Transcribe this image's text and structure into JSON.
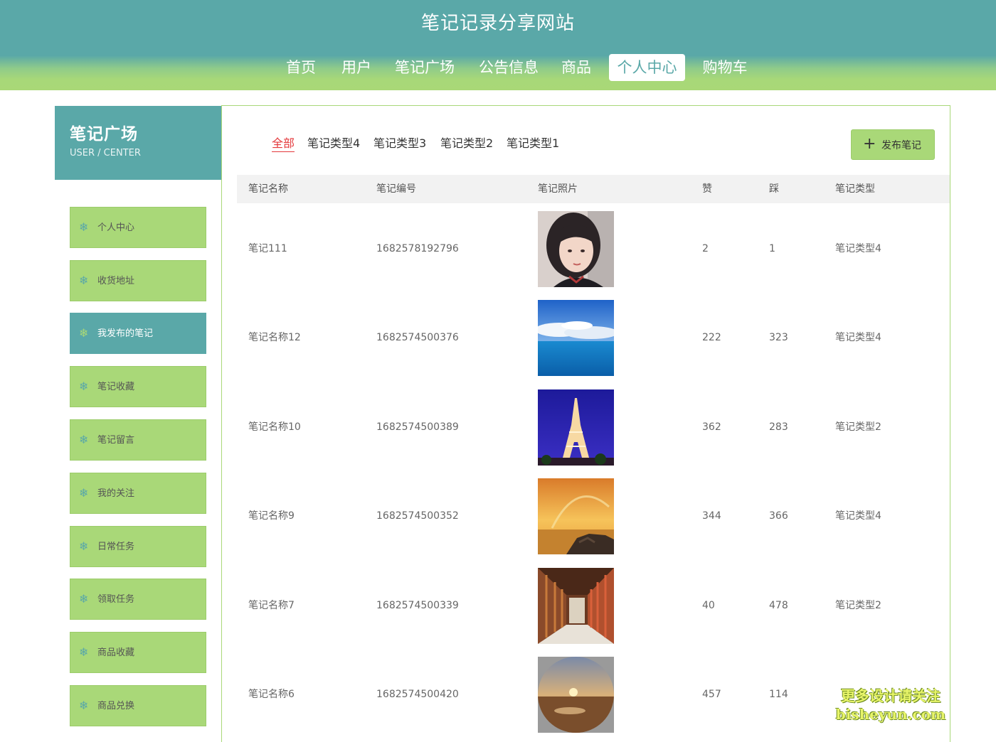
{
  "site": {
    "title": "笔记记录分享网站"
  },
  "nav": [
    "首页",
    "用户",
    "笔记广场",
    "公告信息",
    "商品",
    "个人中心",
    "购物车"
  ],
  "nav_active": "个人中心",
  "sidebar": {
    "title": "笔记广场",
    "subtitle": "USER / CENTER",
    "items": [
      "个人中心",
      "收货地址",
      "我发布的笔记",
      "笔记收藏",
      "笔记留言",
      "我的关注",
      "日常任务",
      "领取任务",
      "商品收藏",
      "商品兑换"
    ],
    "active": "我发布的笔记"
  },
  "filters": [
    "全部",
    "笔记类型4",
    "笔记类型3",
    "笔记类型2",
    "笔记类型1"
  ],
  "filter_active": "全部",
  "publish_label": "发布笔记",
  "table": {
    "headers": [
      "笔记名称",
      "笔记编号",
      "笔记照片",
      "赞",
      "踩",
      "笔记类型"
    ],
    "rows": [
      {
        "name": "笔记111",
        "code": "1682578192796",
        "photo": "portrait-photo",
        "likes": "2",
        "dislikes": "1",
        "type": "笔记类型4"
      },
      {
        "name": "笔记名称12",
        "code": "1682574500376",
        "photo": "sea-sky-photo",
        "likes": "222",
        "dislikes": "323",
        "type": "笔记类型4"
      },
      {
        "name": "笔记名称10",
        "code": "1682574500389",
        "photo": "eiffel-tower-photo",
        "likes": "362",
        "dislikes": "283",
        "type": "笔记类型2"
      },
      {
        "name": "笔记名称9",
        "code": "1682574500352",
        "photo": "sunset-coast-photo",
        "likes": "344",
        "dislikes": "366",
        "type": "笔记类型4"
      },
      {
        "name": "笔记名称7",
        "code": "1682574500339",
        "photo": "corridor-photo",
        "likes": "40",
        "dislikes": "478",
        "type": "笔记类型2"
      },
      {
        "name": "笔记名称6",
        "code": "1682574500420",
        "photo": "desert-sunset-photo",
        "likes": "457",
        "dislikes": "114",
        "type": ""
      }
    ]
  },
  "watermark": {
    "line1": "更多设计请关注",
    "line2": "bisheyun.com"
  },
  "colors": {
    "primary": "#5aa8a8",
    "secondary": "#a9d878",
    "active_filter": "#e4393c"
  }
}
